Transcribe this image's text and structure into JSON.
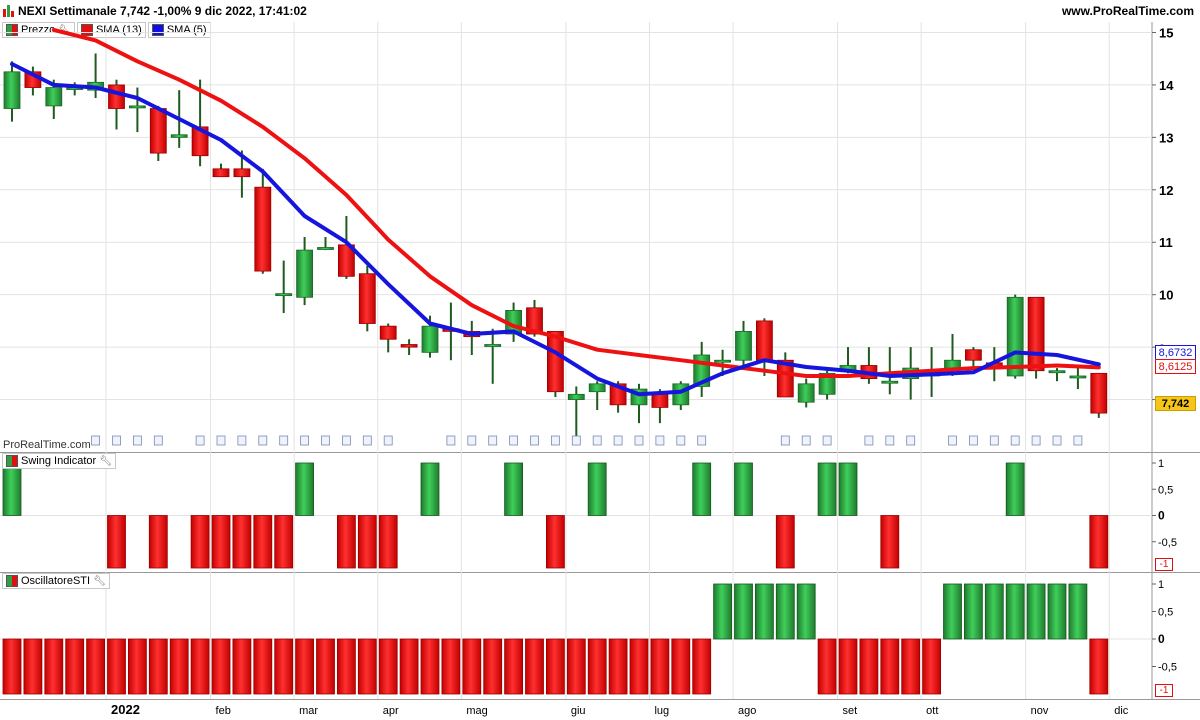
{
  "header": {
    "title": "NEXI Settimanale 7,742 -1,00% 9 dic 2022, 17:41:02",
    "site": "www.ProRealTime.com"
  },
  "legend": {
    "price": "Prezzo",
    "sma13": "SMA (13)",
    "sma5": "SMA (5)"
  },
  "watermark": "ProRealTime.com",
  "panels": {
    "swing": "Swing Indicator",
    "sti": "OscillatoreSTI"
  },
  "price_tags": {
    "sma5": "8,6732",
    "sma13": "8,6125",
    "last": "7,742"
  },
  "sub_axis": {
    "ticks": [
      "1",
      "0,5",
      "0",
      "-0,5"
    ],
    "bottom": "-1"
  },
  "colors": {
    "up": "#2ea043",
    "down": "#e01010",
    "sma13": "#ee1111",
    "sma5": "#1515dd",
    "last_tag_bg": "#f5c518"
  },
  "chart_data": [
    {
      "type": "candlestick",
      "ylim": [
        7.0,
        15.2
      ],
      "yticks": [
        "15",
        "14",
        "13",
        "12",
        "11",
        "10",
        "9",
        "8"
      ],
      "ytick_values": [
        15,
        14,
        13,
        12,
        11,
        10,
        9,
        8
      ],
      "xticks": [
        {
          "label": "2022",
          "index": 4.5
        },
        {
          "label": "feb",
          "index": 9.5
        },
        {
          "label": "mar",
          "index": 13.5
        },
        {
          "label": "apr",
          "index": 17.5
        },
        {
          "label": "mag",
          "index": 21.5
        },
        {
          "label": "giu",
          "index": 26.5
        },
        {
          "label": "lug",
          "index": 30.5
        },
        {
          "label": "ago",
          "index": 34.5
        },
        {
          "label": "set",
          "index": 39.5
        },
        {
          "label": "ott",
          "index": 43.5
        },
        {
          "label": "nov",
          "index": 48.5
        },
        {
          "label": "dic",
          "index": 52.5
        }
      ],
      "candles": [
        [
          13.55,
          14.25,
          14.45,
          13.3
        ],
        [
          14.25,
          13.95,
          14.35,
          13.8
        ],
        [
          13.6,
          13.95,
          14.1,
          13.35
        ],
        [
          13.95,
          13.95,
          14.05,
          13.8
        ],
        [
          13.9,
          14.05,
          14.6,
          13.75
        ],
        [
          14.0,
          13.55,
          14.1,
          13.15
        ],
        [
          13.6,
          13.6,
          13.95,
          13.1
        ],
        [
          13.55,
          12.7,
          13.6,
          12.55
        ],
        [
          13.0,
          13.05,
          13.9,
          12.8
        ],
        [
          13.2,
          12.65,
          14.1,
          12.45
        ],
        [
          12.4,
          12.25,
          12.5,
          12.25
        ],
        [
          12.4,
          12.25,
          12.75,
          11.85
        ],
        [
          12.05,
          10.45,
          12.4,
          10.4
        ],
        [
          10.0,
          10.02,
          10.65,
          9.65
        ],
        [
          9.95,
          10.85,
          11.1,
          9.8
        ],
        [
          10.9,
          10.9,
          11.1,
          10.85
        ],
        [
          10.95,
          10.35,
          11.5,
          10.3
        ],
        [
          10.4,
          9.45,
          10.55,
          9.3
        ],
        [
          9.4,
          9.15,
          9.45,
          8.9
        ],
        [
          9.05,
          9.0,
          9.15,
          8.85
        ],
        [
          8.9,
          9.4,
          9.6,
          8.8
        ],
        [
          9.35,
          9.3,
          9.85,
          8.75
        ],
        [
          9.3,
          9.2,
          9.5,
          8.85
        ],
        [
          9.05,
          9.05,
          9.35,
          8.3
        ],
        [
          9.25,
          9.7,
          9.85,
          9.1
        ],
        [
          9.75,
          9.25,
          9.9,
          9.2
        ],
        [
          9.3,
          8.15,
          9.3,
          8.05
        ],
        [
          8.0,
          8.1,
          8.25,
          7.3
        ],
        [
          8.15,
          8.3,
          8.35,
          7.8
        ],
        [
          8.3,
          7.9,
          8.35,
          7.75
        ],
        [
          7.9,
          8.2,
          8.3,
          7.55
        ],
        [
          8.1,
          7.85,
          8.2,
          7.55
        ],
        [
          7.9,
          8.3,
          8.35,
          7.8
        ],
        [
          8.25,
          8.85,
          9.1,
          8.05
        ],
        [
          8.75,
          8.75,
          8.95,
          8.45
        ],
        [
          8.75,
          9.3,
          9.5,
          8.65
        ],
        [
          9.5,
          8.75,
          9.55,
          8.45
        ],
        [
          8.75,
          8.05,
          8.9,
          8.05
        ],
        [
          7.95,
          8.3,
          8.4,
          7.85
        ],
        [
          8.1,
          8.5,
          8.55,
          8.0
        ],
        [
          8.55,
          8.65,
          9.0,
          8.5
        ],
        [
          8.65,
          8.4,
          9.0,
          8.3
        ],
        [
          8.35,
          8.35,
          9.0,
          8.1
        ],
        [
          8.4,
          8.6,
          9.0,
          8.0
        ],
        [
          8.45,
          8.55,
          9.0,
          8.05
        ],
        [
          8.6,
          8.75,
          9.25,
          8.45
        ],
        [
          8.95,
          8.75,
          9.0,
          8.6
        ],
        [
          8.7,
          8.6,
          9.0,
          8.35
        ],
        [
          8.45,
          9.95,
          10.0,
          8.4
        ],
        [
          9.95,
          8.55,
          9.95,
          8.4
        ],
        [
          8.55,
          8.55,
          8.6,
          8.35
        ],
        [
          8.45,
          8.45,
          8.65,
          8.2
        ],
        [
          8.5,
          7.742,
          8.5,
          7.65
        ]
      ],
      "series": [
        {
          "name": "SMA (13)",
          "points": [
            [
              2,
              15.05
            ],
            [
              4,
              14.85
            ],
            [
              6,
              14.45
            ],
            [
              8,
              14.1
            ],
            [
              10,
              13.7
            ],
            [
              12,
              13.2
            ],
            [
              14,
              12.6
            ],
            [
              16,
              11.9
            ],
            [
              18,
              11.05
            ],
            [
              20,
              10.35
            ],
            [
              22,
              9.8
            ],
            [
              24,
              9.4
            ],
            [
              26,
              9.2
            ],
            [
              28,
              8.95
            ],
            [
              30,
              8.85
            ],
            [
              32,
              8.75
            ],
            [
              34,
              8.65
            ],
            [
              36,
              8.55
            ],
            [
              38,
              8.45
            ],
            [
              40,
              8.45
            ],
            [
              42,
              8.5
            ],
            [
              44,
              8.55
            ],
            [
              46,
              8.6
            ],
            [
              48,
              8.62
            ],
            [
              50,
              8.65
            ],
            [
              52,
              8.6125
            ]
          ]
        },
        {
          "name": "SMA (5)",
          "points": [
            [
              0,
              14.4
            ],
            [
              2,
              14.0
            ],
            [
              4,
              13.95
            ],
            [
              6,
              13.75
            ],
            [
              8,
              13.35
            ],
            [
              10,
              12.95
            ],
            [
              12,
              12.35
            ],
            [
              14,
              11.5
            ],
            [
              16,
              11.0
            ],
            [
              18,
              10.2
            ],
            [
              20,
              9.45
            ],
            [
              22,
              9.25
            ],
            [
              24,
              9.3
            ],
            [
              26,
              8.9
            ],
            [
              28,
              8.4
            ],
            [
              30,
              8.1
            ],
            [
              32,
              8.15
            ],
            [
              34,
              8.5
            ],
            [
              36,
              8.75
            ],
            [
              38,
              8.62
            ],
            [
              40,
              8.55
            ],
            [
              42,
              8.45
            ],
            [
              44,
              8.48
            ],
            [
              46,
              8.52
            ],
            [
              48,
              8.9
            ],
            [
              50,
              8.85
            ],
            [
              52,
              8.6732
            ]
          ]
        }
      ],
      "last": 7.742
    },
    {
      "type": "bar",
      "title": "Swing Indicator",
      "ylim": [
        -1,
        1
      ],
      "values": [
        1,
        0,
        0,
        0,
        0,
        -1,
        0,
        -1,
        0,
        -1,
        -1,
        -1,
        -1,
        -1,
        1,
        0,
        -1,
        -1,
        -1,
        0,
        1,
        0,
        0,
        0,
        1,
        0,
        -1,
        0,
        1,
        0,
        0,
        0,
        0,
        1,
        0,
        1,
        0,
        -1,
        0,
        1,
        1,
        0,
        -1,
        0,
        0,
        0,
        0,
        0,
        1,
        0,
        0,
        0,
        -1
      ]
    },
    {
      "type": "bar",
      "title": "OscillatoreSTI",
      "ylim": [
        -1,
        1
      ],
      "values": [
        -1,
        -1,
        -1,
        -1,
        -1,
        -1,
        -1,
        -1,
        -1,
        -1,
        -1,
        -1,
        -1,
        -1,
        -1,
        -1,
        -1,
        -1,
        -1,
        -1,
        -1,
        -1,
        -1,
        -1,
        -1,
        -1,
        -1,
        -1,
        -1,
        -1,
        -1,
        -1,
        -1,
        -1,
        1,
        1,
        1,
        1,
        1,
        -1,
        -1,
        -1,
        -1,
        -1,
        -1,
        1,
        1,
        1,
        1,
        1,
        1,
        1,
        -1
      ]
    }
  ]
}
